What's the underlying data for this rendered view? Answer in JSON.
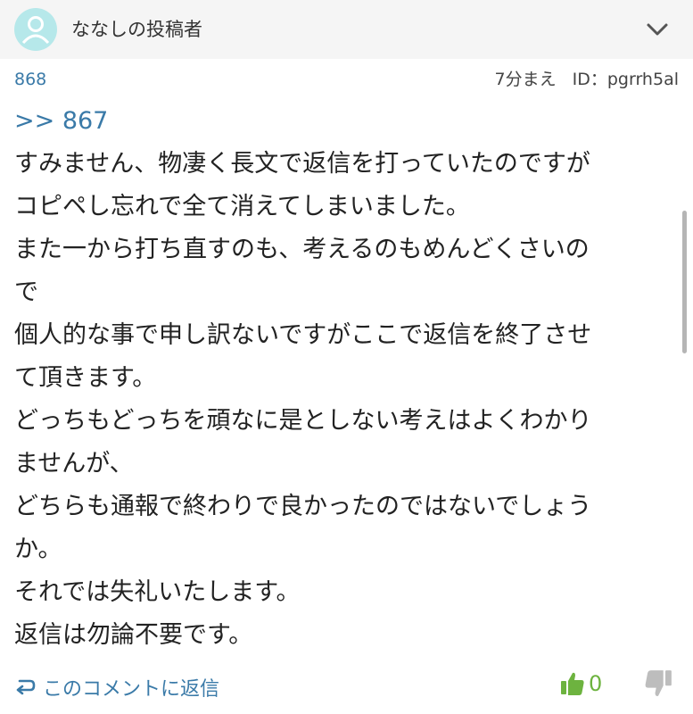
{
  "header": {
    "poster_name": "ななしの投稿者",
    "avatar_icon": "user-avatar-icon",
    "expand_icon": "chevron-down-icon"
  },
  "comment": {
    "number": "868",
    "time": "7分まえ",
    "id_label": "ID：pgrrh5al",
    "reply_to": ">> 867",
    "lines": [
      "すみません、物凄く長文で返信を打っていたのですが",
      "コピペし忘れで全て消えてしまいました。",
      "また一から打ち直すのも、考えるのもめんどくさいの",
      "で",
      "個人的な事で申し訳ないですがここで返信を終了させ",
      "て頂きます。",
      "どっちもどっちを頑なに是としない考えはよくわかり",
      "ませんが、",
      "どちらも通報で終わりで良かったのではないでしょう",
      "か。",
      "それでは失礼いたします。",
      "返信は勿論不要です。"
    ]
  },
  "footer": {
    "reply_label": "このコメントに返信",
    "reply_icon": "reply-arrow-icon",
    "like_icon": "thumbs-up-icon",
    "like_count": "0",
    "dislike_icon": "thumbs-down-icon"
  },
  "colors": {
    "link": "#3a7aa8",
    "like": "#6db33f",
    "dislike": "#bdbdbd",
    "header_bg": "#f5f5f5",
    "avatar": "#a8e3e6"
  }
}
